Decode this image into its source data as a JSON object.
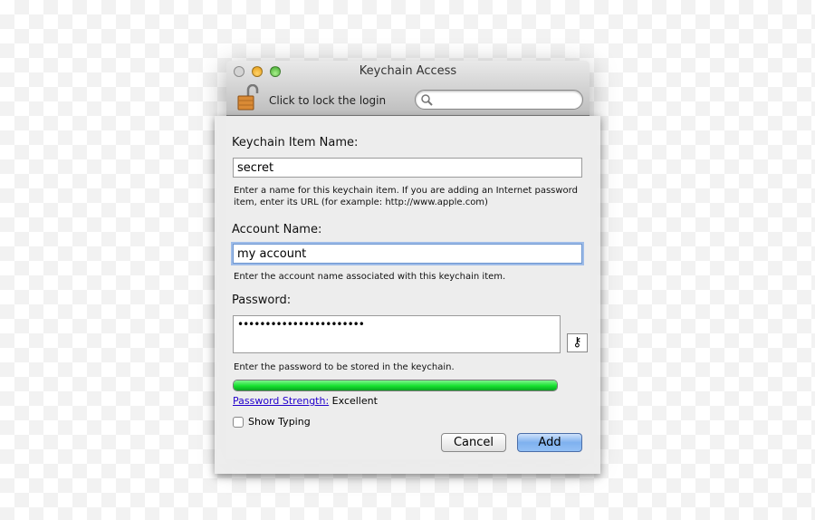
{
  "window": {
    "title": "Keychain Access",
    "lock_label": "Click to lock the login",
    "search_placeholder": ""
  },
  "sheet": {
    "item_name_label": "Keychain Item Name:",
    "item_name_value": "secret",
    "item_name_help_1": "Enter a name for this keychain item. If you are adding an Internet password",
    "item_name_help_2": "item, enter its URL (for example: http://www.apple.com)",
    "account_label": "Account Name:",
    "account_value": "my account",
    "account_help": "Enter the account name associated with this keychain item.",
    "password_label": "Password:",
    "password_value": "•••••••••••••••••••••••",
    "password_help": "Enter the password to be stored in the keychain.",
    "strength_link": "Password Strength:",
    "strength_value": "Excellent",
    "strength_level": 1.0,
    "show_typing_label": "Show Typing",
    "show_typing_checked": false,
    "cancel_label": "Cancel",
    "add_label": "Add"
  },
  "colors": {
    "strength_bar": "#16e02e",
    "default_button": "#7fb1ef"
  }
}
